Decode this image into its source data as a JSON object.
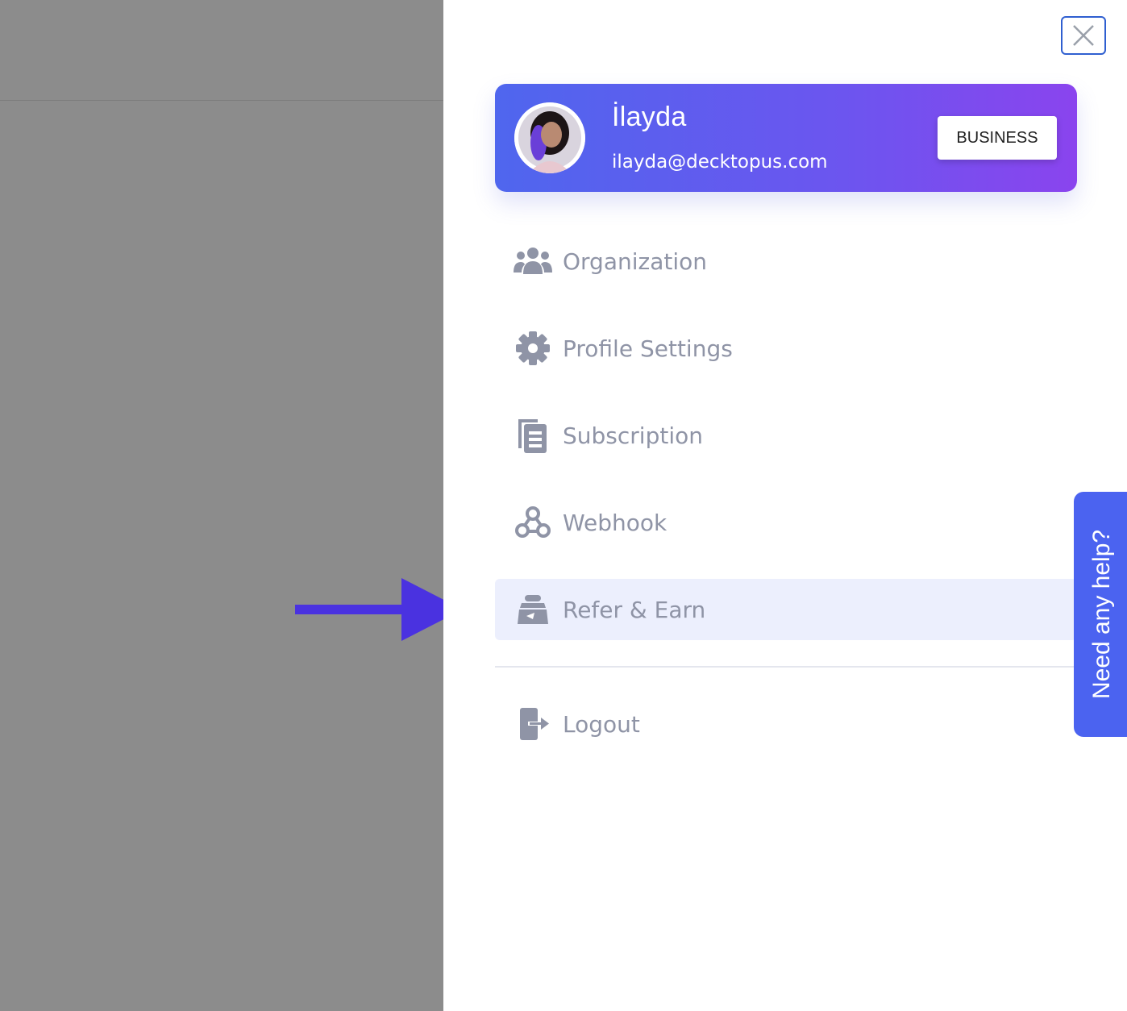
{
  "profile": {
    "name": "İlayda",
    "email": "ilayda@decktopus.com",
    "plan_label": "BUSINESS"
  },
  "menu": {
    "items": [
      {
        "label": "Organization",
        "icon": "users-group-icon"
      },
      {
        "label": "Profile Settings",
        "icon": "gear-icon"
      },
      {
        "label": "Subscription",
        "icon": "document-copy-icon"
      },
      {
        "label": "Webhook",
        "icon": "webhook-icon"
      },
      {
        "label": "Refer & Earn",
        "icon": "gift-bag-icon",
        "active": true
      }
    ],
    "logout": {
      "label": "Logout",
      "icon": "logout-icon"
    }
  },
  "help": {
    "label": "Need any help?"
  },
  "colors": {
    "accent": "#4b63f0",
    "gradient_start": "#4f66ee",
    "gradient_end": "#8a44ee",
    "menu_text": "#8f94a6",
    "active_bg": "#eceffd",
    "overlay": "#8c8c8c",
    "arrow": "#4a32e0"
  }
}
